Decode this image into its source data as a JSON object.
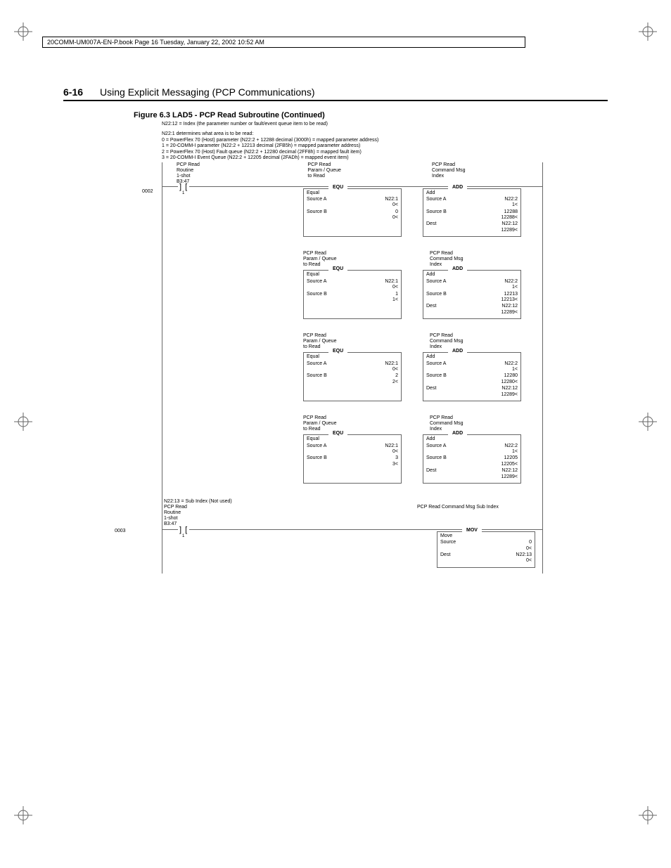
{
  "book_header": "20COMM-UM007A-EN-P.book  Page 16  Tuesday, January 22, 2002  10:52 AM",
  "page_number": "6-16",
  "page_title": "Using Explicit Messaging (PCP Communications)",
  "figure_caption": "Figure 6.3   LAD5 - PCP Read Subroutine (Continued)",
  "intro_line": "N22:12 = Index (the parameter number or fault/event queue item to be read)",
  "notes": {
    "l1": "N22:1 determines what area is to be read:",
    "l2": "0 = PowerFlex 70 (Host) parameter (N22:2 + 12288 decimal (3000h) = mapped parameter address)",
    "l3": "1 = 20-COMM-I parameter (N22:2 + 12213 decimal (2FB5h) = mapped parameter address)",
    "l4": "2 = PowerFlex 70 (Host) Fault queue (N22:2 + 12280 decimal (2FF8h) = mapped fault item)",
    "l5": "3 = 20-COMM-I Event Queue (N22:2 + 12205 decimal (2FADh) = mapped event item)"
  },
  "rung2_num": "0002",
  "rung3_num": "0003",
  "labels": {
    "pcp_read_routine": "PCP Read\nRoutine\n1-shot\nB3:47",
    "pcp_read_param_queue": "PCP Read\nParam / Queue\nto Read",
    "pcp_read_cmd_msg_index": "PCP Read\nCommand Msg\nIndex",
    "pcp_read_cmd_msg_sub": "PCP Read\nCommand Msg\nSub Index",
    "sub_index_note": "N22:13 = Sub Index (Not used)"
  },
  "tags": {
    "equ": "EQU",
    "add": "ADD",
    "mov": "MOV"
  },
  "equ_label": "Equal",
  "add_label": "Add",
  "mov_label": "Move",
  "rows": {
    "source_a": "Source A",
    "source_b": "Source B",
    "dest": "Dest",
    "source": "Source"
  },
  "blocks": [
    {
      "equ": {
        "sa": "N22:1",
        "sa_sub": "0<",
        "sb": "0",
        "sb_sub": "0<"
      },
      "add": {
        "sa": "N22:2",
        "sa_sub": "1<",
        "sb": "12288",
        "sb_sub": "12288<",
        "d": "N22:12",
        "d_sub": "12289<"
      }
    },
    {
      "equ": {
        "sa": "N22:1",
        "sa_sub": "0<",
        "sb": "1",
        "sb_sub": "1<"
      },
      "add": {
        "sa": "N22:2",
        "sa_sub": "1<",
        "sb": "12213",
        "sb_sub": "12213<",
        "d": "N22:12",
        "d_sub": "12289<"
      }
    },
    {
      "equ": {
        "sa": "N22:1",
        "sa_sub": "0<",
        "sb": "2",
        "sb_sub": "2<"
      },
      "add": {
        "sa": "N22:2",
        "sa_sub": "1<",
        "sb": "12280",
        "sb_sub": "12280<",
        "d": "N22:12",
        "d_sub": "12289<"
      }
    },
    {
      "equ": {
        "sa": "N22:1",
        "sa_sub": "0<",
        "sb": "3",
        "sb_sub": "3<"
      },
      "add": {
        "sa": "N22:2",
        "sa_sub": "1<",
        "sb": "12205",
        "sb_sub": "12205<",
        "d": "N22:12",
        "d_sub": "12289<"
      }
    }
  ],
  "mov_block": {
    "src": "0",
    "src_sub": "0<",
    "d": "N22:13",
    "d_sub": "0<"
  },
  "chart_data": {
    "type": "table",
    "title": "LAD5 - PCP Read Subroutine rungs 0002-0003",
    "rung_0002": {
      "contact": "B3:47/1",
      "branches": [
        {
          "EQU": {
            "Source A": "N22:1",
            "Source B": 0
          },
          "ADD": {
            "Source A": "N22:2",
            "Source B": 12288,
            "Dest": "N22:12"
          }
        },
        {
          "EQU": {
            "Source A": "N22:1",
            "Source B": 1
          },
          "ADD": {
            "Source A": "N22:2",
            "Source B": 12213,
            "Dest": "N22:12"
          }
        },
        {
          "EQU": {
            "Source A": "N22:1",
            "Source B": 2
          },
          "ADD": {
            "Source A": "N22:2",
            "Source B": 12280,
            "Dest": "N22:12"
          }
        },
        {
          "EQU": {
            "Source A": "N22:1",
            "Source B": 3
          },
          "ADD": {
            "Source A": "N22:2",
            "Source B": 12205,
            "Dest": "N22:12"
          }
        }
      ]
    },
    "rung_0003": {
      "contact": "B3:47/1",
      "MOV": {
        "Source": 0,
        "Dest": "N22:13"
      }
    }
  }
}
